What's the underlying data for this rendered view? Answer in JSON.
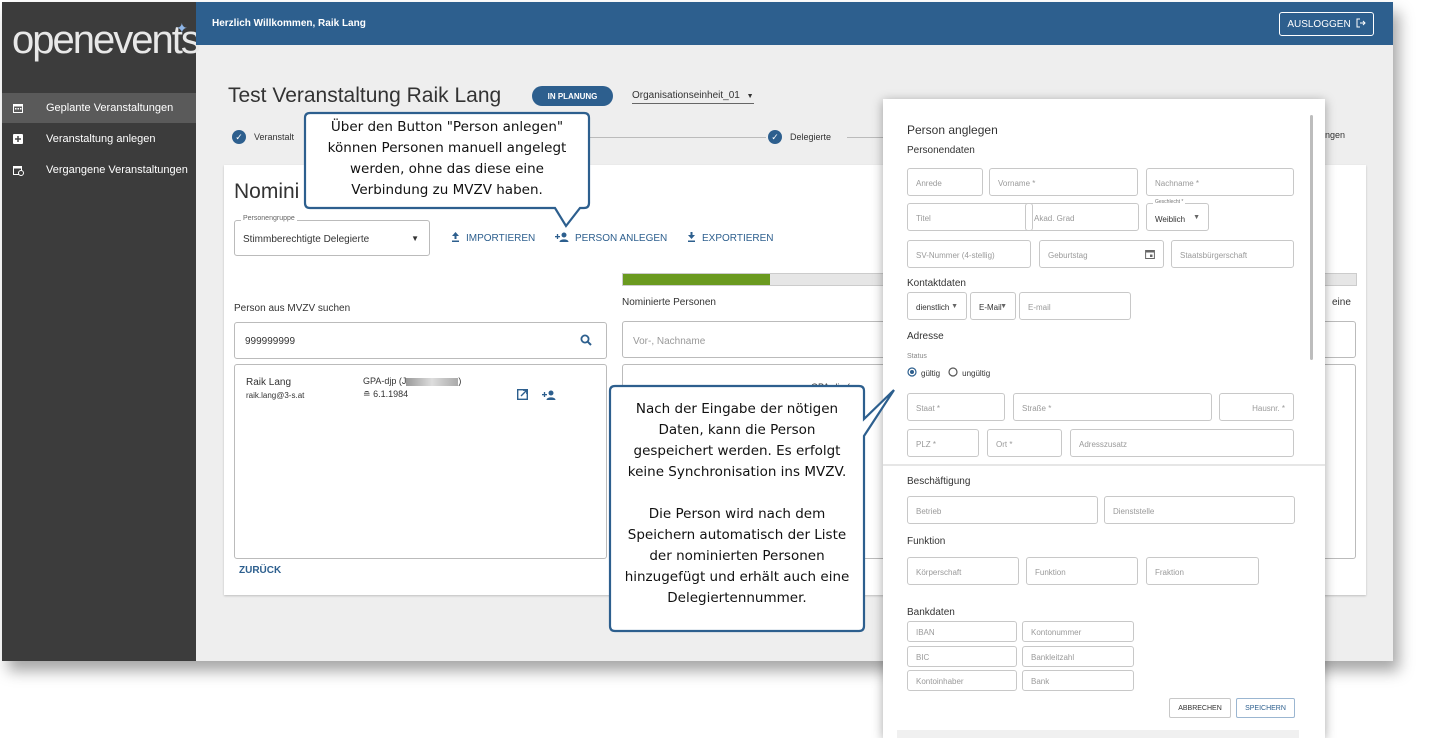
{
  "sidebar": {
    "logo": "openevents",
    "items": [
      {
        "label": "Geplante Veranstaltungen",
        "icon": "calendar-icon"
      },
      {
        "label": "Veranstaltung anlegen",
        "icon": "add-box-icon"
      },
      {
        "label": "Vergangene Veranstaltungen",
        "icon": "calendar-history-icon"
      }
    ]
  },
  "header": {
    "welcome": "Herzlich Willkommen, Raik Lang",
    "logout": "AUSLOGGEN"
  },
  "event": {
    "title": "Test Veranstaltung Raik Lang",
    "status": "IN PLANUNG",
    "org_unit": "Organisationseinheit_01"
  },
  "stepper": {
    "step1": "Veranstalt",
    "step2": "Delegierte",
    "step3": "ngen"
  },
  "card": {
    "title": "Nomini",
    "group_label": "Personengruppe",
    "group_value": "Stimmberechtigte Delegierte",
    "import": "IMPORTIEREN",
    "person_anlegen": "PERSON ANLEGEN",
    "export": "EXPORTIEREN",
    "progress": 0.2,
    "search_label": "Person aus MVZV suchen",
    "search_value": "999999999",
    "result": {
      "name": "Raik Lang",
      "email": "raik.lang@3-s.at",
      "org": "GPA-djp (J",
      "org_end": ")",
      "birth": "6.1.1984"
    },
    "nominated_label": "Nominierte Personen",
    "nominated_placeholder": "Vor-, Nachname",
    "nominated_row_org": "GPA-djp (",
    "right_label": "eine",
    "back": "ZURÜCK"
  },
  "dialog": {
    "title": "Person anglegen",
    "sec_person": "Personendaten",
    "anrede": "Anrede",
    "vorname": "Vorname *",
    "nachname": "Nachname *",
    "titel": "Titel",
    "akad": "Akad. Grad",
    "geschlecht_label": "Geschlecht *",
    "geschlecht": "Weiblich",
    "sv": "SV-Nummer (4-stellig)",
    "geburtstag": "Geburtstag",
    "staat_b": "Staatsbürgerschaft",
    "sec_kontakt": "Kontaktdaten",
    "dienstlich": "dienstlich",
    "email_type": "E-Mail",
    "email": "E-mail",
    "sec_adresse": "Adresse",
    "status_label": "Status",
    "gueltig": "gültig",
    "ungueltig": "ungültig",
    "staat": "Staat *",
    "strasse": "Straße *",
    "hausnr": "Hausnr. *",
    "plz": "PLZ *",
    "ort": "Ort *",
    "adresszusatz": "Adresszusatz",
    "sec_besch": "Beschäftigung",
    "betrieb": "Betrieb",
    "dienststelle": "Dienststelle",
    "sec_funktion": "Funktion",
    "koerperschaft": "Körperschaft",
    "funktion": "Funktion",
    "fraktion": "Fraktion",
    "sec_bank": "Bankdaten",
    "iban": "IBAN",
    "kontonummer": "Kontonummer",
    "bic": "BIC",
    "bankleitzahl": "Bankleitzahl",
    "kontoinhaber": "Kontoinhaber",
    "bank": "Bank",
    "abbrechen": "ABBRECHEN",
    "speichern": "SPEICHERN"
  },
  "callouts": {
    "top": [
      "Über den Button \"Person anlegen\"",
      "können Personen manuell angelegt",
      "werden, ohne das diese eine",
      "Verbindung zu MVZV haben."
    ],
    "middle": [
      "Nach der  Eingabe der nötigen",
      "Daten, kann die Person",
      "gespeichert werden. Es erfolgt",
      "keine Synchronisation ins MVZV.",
      "",
      "Die Person wird nach dem",
      "Speichern automatisch der Liste",
      "der nominierten Personen",
      "hinzugefügt und erhält auch eine",
      "Delegiertennummer."
    ]
  },
  "colors": {
    "primary": "#2d5f8e",
    "sidebar": "#3c3c3c",
    "progress": "#6a9a1f"
  }
}
